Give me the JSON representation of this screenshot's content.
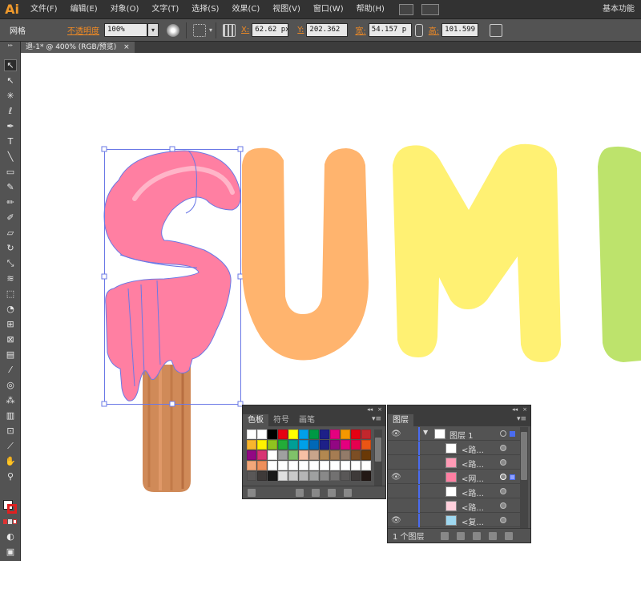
{
  "app": {
    "logo": "Ai",
    "workspace": "基本功能"
  },
  "menu": [
    "文件(F)",
    "编辑(E)",
    "对象(O)",
    "文字(T)",
    "选择(S)",
    "效果(C)",
    "视图(V)",
    "窗口(W)",
    "帮助(H)"
  ],
  "control": {
    "object_type": "网格",
    "opacity_label": "不透明度",
    "opacity_value": "100%",
    "x_label": "X:",
    "x_value": "62.62 px",
    "y_label": "Y:",
    "y_value": "202.362",
    "w_label": "宽:",
    "w_value": "54.157 p",
    "h_label": "高:",
    "h_value": "101.599"
  },
  "document": {
    "tab_label": "退-1* @ 400% (RGB/预览)",
    "close_glyph": "×"
  },
  "artwork": {
    "letters": [
      "S",
      "U",
      "M",
      "M"
    ]
  },
  "swatches_panel": {
    "tabs": [
      "色板",
      "符号",
      "画笔"
    ],
    "swatch_rows": [
      [
        "#ffffff",
        "#ffffff",
        "#000000",
        "#e60012",
        "#ffff00",
        "#00a0e9",
        "#009944",
        "#1d2088",
        "#e4007f",
        "#f39800",
        "#e60012",
        "#c1272d",
        "#601986",
        "#8c3f97"
      ],
      [
        "#f8b62d",
        "#fff100",
        "#8fc31f",
        "#22ac38",
        "#009e96",
        "#00a0e9",
        "#0068b7",
        "#1d2088",
        "#920783",
        "#e4007f",
        "#e5004f",
        "#ea5514",
        "#f39800",
        "#ffffff"
      ],
      [
        "#920783",
        "#d83474",
        "#ffffff",
        "#9fa0a0",
        "#80c269",
        "#f6bfa4",
        "#c8a48b",
        "#b28850",
        "#a57c52",
        "#937b69",
        "#7d4e24",
        "#6a3906",
        "#4b2c20",
        "#ffffff"
      ],
      [
        "#f3a779",
        "#ee8f5b",
        "#ffffff",
        "#ffffff",
        "#ffffff",
        "#ffffff",
        "#ffffff",
        "#ffffff",
        "#ffffff",
        "#ffffff",
        "#ffffff",
        "#ffffff",
        "#ffffff",
        "#ffffff"
      ],
      [
        "#595757",
        "#3e3a39",
        "#1a1a1a",
        "#e0e0e0",
        "#c9c9c9",
        "#b5b5b6",
        "#9fa0a0",
        "#898989",
        "#727171",
        "#595757",
        "#3e3a39",
        "#231815",
        "#ffffff",
        "#ffffff"
      ]
    ]
  },
  "layers_panel": {
    "tab": "图层",
    "layer_name": "图层 1",
    "sublayers": [
      "<路...",
      "<路...",
      "<网...",
      "<路...",
      "<路...",
      "<复..."
    ],
    "footer_text": "1 个图层"
  }
}
